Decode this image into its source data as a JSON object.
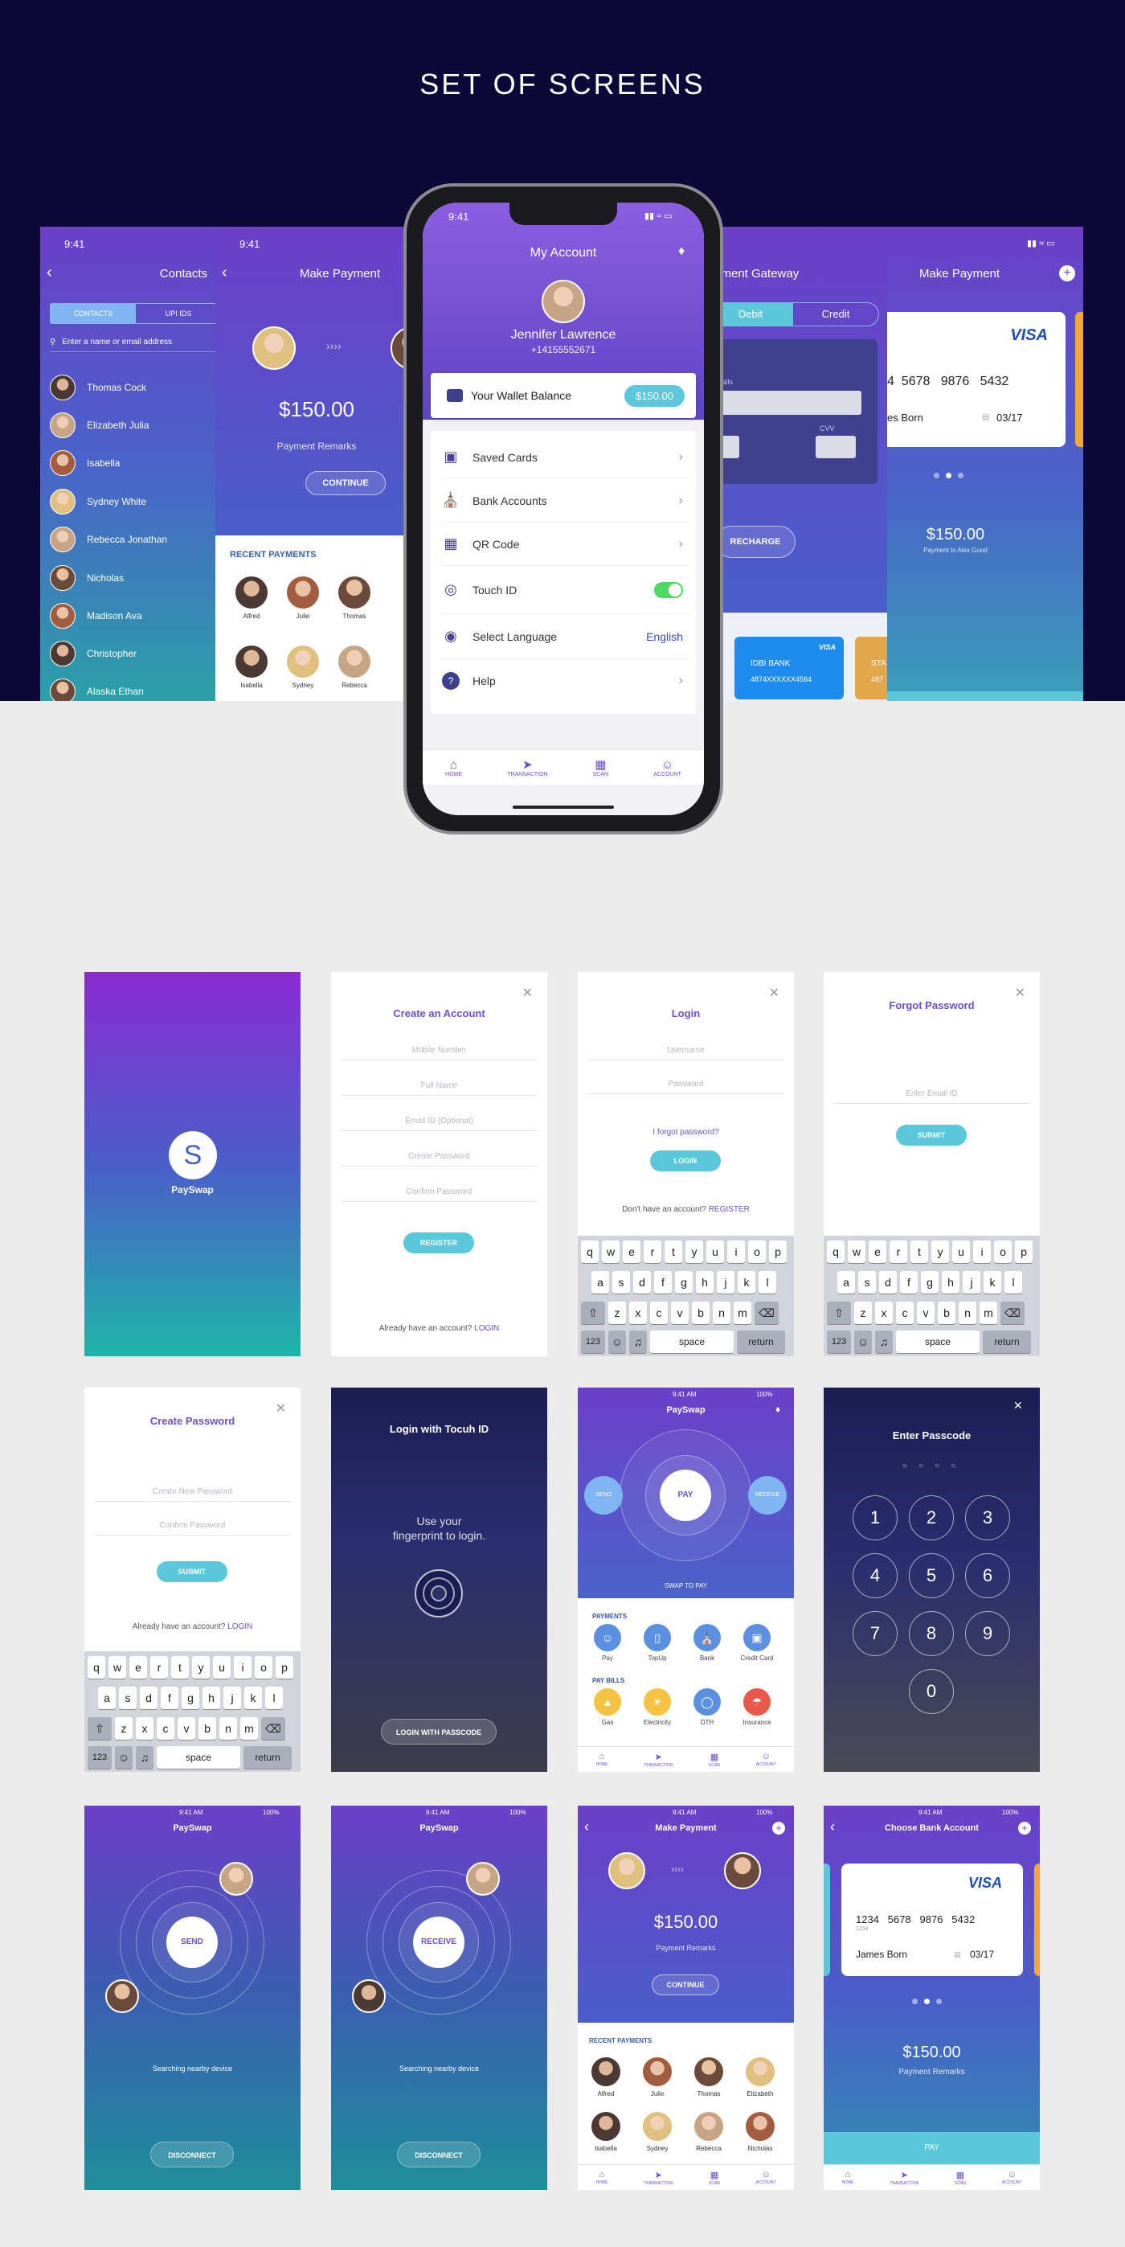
{
  "hero": {
    "title": "SET OF SCREENS"
  },
  "contacts": {
    "time": "9:41",
    "title": "Contacts",
    "tabs": [
      "CONTACTS",
      "UPI IDS"
    ],
    "search_placeholder": "Enter a name or email address",
    "list": [
      "Thomas Cock",
      "Elizabeth Julia",
      "Isabella",
      "Sydney White",
      "Rebecca Jonathan",
      "Nicholas",
      "Madison Ava",
      "Christopher",
      "Alaska Ethan"
    ]
  },
  "make_payment_back": {
    "time": "9:41",
    "title": "Make Payment",
    "amount": "$150.00",
    "remarks": "Payment Remarks",
    "continue": "CONTINUE",
    "recent_title": "RECENT PAYMENTS",
    "recent": [
      "Alfred",
      "Julie",
      "Thomas",
      "Isabella",
      "Sydney",
      "Rebecca"
    ]
  },
  "gateway_back": {
    "title": "yment Gateway",
    "tabs": [
      "Debit",
      "Credit"
    ],
    "details": "details",
    "cvv": "CVV",
    "recharge": "RECHARGE",
    "bank1_name": "IDBI BANK",
    "bank1_num": "4874XXXXXX4584",
    "bank1_brand": "VISA",
    "bank2_name": "STA",
    "bank2_num": "487"
  },
  "make_payment_right": {
    "title": "Make Payment",
    "visa": "VISA",
    "card_num": "4  5678   9876   5432",
    "holder": "es Born",
    "expiry": "03/17",
    "amount": "$150.00",
    "to": "Payment to Alex Good"
  },
  "phone": {
    "time": "9:41",
    "title": "My Account",
    "name": "Jennifer Lawrence",
    "phone": "+14155552671",
    "wallet_label": "Your Wallet Balance",
    "wallet_value": "$150.00",
    "menu": [
      "Saved Cards",
      "Bank Accounts",
      "QR Code",
      "Touch ID",
      "Select Language",
      "Help"
    ],
    "language": "English",
    "tabs": [
      "HOME",
      "TRANSACTION",
      "SCAN",
      "ACCOUNT"
    ]
  },
  "splash": {
    "logo": "S",
    "name": "PaySwap"
  },
  "create_account": {
    "title": "Create an Account",
    "fields": [
      "Mobile Number",
      "Full Name",
      "Email ID (Optional)",
      "Create Password",
      "Confirm Password"
    ],
    "register": "REGISTER",
    "footer_text": "Already  have an account?",
    "footer_link": "LOGIN"
  },
  "login": {
    "title": "Login",
    "fields": [
      "Username",
      "Password"
    ],
    "forgot": "I forgot password?",
    "login": "LOGIN",
    "footer_text": "Don't have an account?",
    "footer_link": "REGISTER"
  },
  "forgot": {
    "title": "Forgot Password",
    "field": "Enter Email ID",
    "submit": "SUBMIT"
  },
  "keyboard": {
    "row1": [
      "q",
      "w",
      "e",
      "r",
      "t",
      "y",
      "u",
      "i",
      "o",
      "p"
    ],
    "row2": [
      "a",
      "s",
      "d",
      "f",
      "g",
      "h",
      "j",
      "k",
      "l"
    ],
    "row3": [
      "z",
      "x",
      "c",
      "v",
      "b",
      "n",
      "m"
    ],
    "num": "123",
    "space": "space",
    "return": "return"
  },
  "create_password": {
    "title": "Create Password",
    "fields": [
      "Create New Password",
      "Confirm Password"
    ],
    "submit": "SUBMIT",
    "footer_text": "Already  have an account?",
    "footer_link": "LOGIN"
  },
  "touch_id": {
    "title": "Login with Tocuh ID",
    "line1": "Use your",
    "line2": "fingerprint to login.",
    "button": "LOGIN WITH PASSCODE"
  },
  "payswap_home": {
    "time": "9:41 AM",
    "battery": "100%",
    "title": "PaySwap",
    "send": "SEND",
    "pay": "PAY",
    "receive": "RECEIVE",
    "swap": "SWAP TO PAY",
    "payments_title": "PAYMENTS",
    "payments": [
      "Pay",
      "TopUp",
      "Bank",
      "Credit Card"
    ],
    "bills_title": "PAY BILLS",
    "bills": [
      "Gas",
      "Electricity",
      "DTH",
      "Insurance"
    ],
    "tabs": [
      "HOME",
      "TRANSACTION",
      "SCAN",
      "ACCOUNT"
    ]
  },
  "passcode": {
    "title": "Enter Passcode",
    "keys": [
      "1",
      "2",
      "3",
      "4",
      "5",
      "6",
      "7",
      "8",
      "9",
      "0"
    ]
  },
  "send_screen": {
    "time": "9:41 AM",
    "battery": "100%",
    "title": "PaySwap",
    "center": "SEND",
    "status": "Searching nearby device",
    "button": "DISCONNECT"
  },
  "receive_screen": {
    "time": "9:41 AM",
    "battery": "100%",
    "title": "PaySwap",
    "center": "RECEIVE",
    "status": "Searching nearby device",
    "button": "DISCONNECT"
  },
  "make_payment_small": {
    "time": "9:41 AM",
    "battery": "100%",
    "title": "Make Payment",
    "amount": "$150.00",
    "remarks": "Payment Remarks",
    "continue": "CONTINUE",
    "recent_title": "RECENT PAYMENTS",
    "recent": [
      "Alfred",
      "Julie",
      "Thomas",
      "Elizabeth",
      "Isabella",
      "Sydney",
      "Rebecca",
      "Nicholas"
    ],
    "tabs": [
      "HOME",
      "TRANSACTION",
      "SCAN",
      "ACCOUNT"
    ]
  },
  "choose_bank": {
    "time": "9:41 AM",
    "battery": "100%",
    "title": "Choose Bank Account",
    "visa": "VISA",
    "card_num": "1234   5678   9876   5432",
    "card_sub": "1234",
    "holder": "James Born",
    "expiry": "03/17",
    "amount": "$150.00",
    "remarks": "Payment Remarks",
    "pay": "PAY",
    "tabs": [
      "HOME",
      "TRANSACTION",
      "SCAN",
      "ACCOUNT"
    ]
  }
}
